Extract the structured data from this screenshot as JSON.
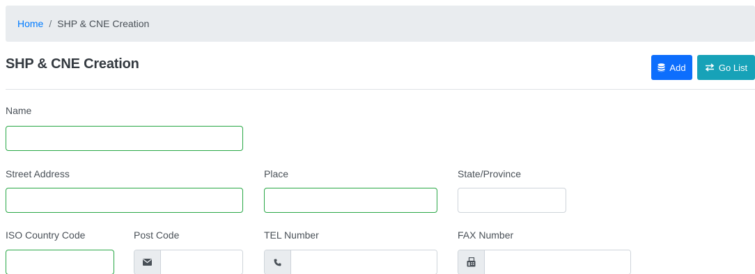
{
  "breadcrumb": {
    "home": "Home",
    "separator": "/",
    "current": "SHP & CNE Creation"
  },
  "page": {
    "title": "SHP & CNE Creation"
  },
  "buttons": {
    "add": {
      "label": "Add",
      "icon": "database-icon",
      "color": "#0d6efd"
    },
    "go_list": {
      "label": "Go List",
      "icon": "exchange-icon",
      "color": "#17a2b8"
    }
  },
  "form": {
    "name": {
      "label": "Name",
      "value": ""
    },
    "street_address": {
      "label": "Street Address",
      "value": ""
    },
    "place": {
      "label": "Place",
      "value": ""
    },
    "state_province": {
      "label": "State/Province",
      "value": ""
    },
    "iso_country_code": {
      "label": "ISO Country Code",
      "value": ""
    },
    "post_code": {
      "label": "Post Code",
      "value": "",
      "icon": "envelope-icon"
    },
    "tel_number": {
      "label": "TEL Number",
      "value": "",
      "icon": "phone-icon"
    },
    "fax_number": {
      "label": "FAX Number",
      "value": "",
      "icon": "fax-icon"
    }
  },
  "colors": {
    "valid_border": "#28a745",
    "default_border": "#ced4da",
    "link": "#007bff"
  }
}
